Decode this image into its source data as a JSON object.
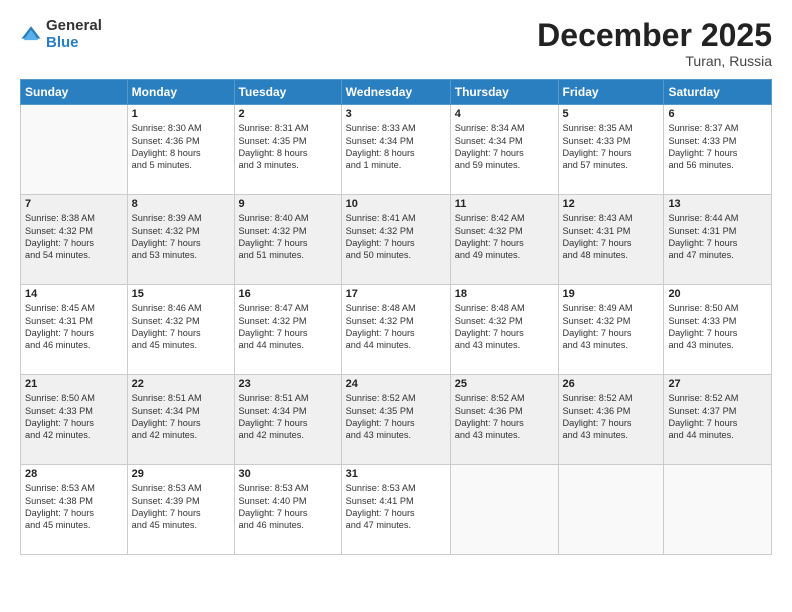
{
  "logo": {
    "general": "General",
    "blue": "Blue"
  },
  "title": "December 2025",
  "location": "Turan, Russia",
  "headers": [
    "Sunday",
    "Monday",
    "Tuesday",
    "Wednesday",
    "Thursday",
    "Friday",
    "Saturday"
  ],
  "rows": [
    [
      {
        "day": "",
        "info": ""
      },
      {
        "day": "1",
        "info": "Sunrise: 8:30 AM\nSunset: 4:36 PM\nDaylight: 8 hours\nand 5 minutes."
      },
      {
        "day": "2",
        "info": "Sunrise: 8:31 AM\nSunset: 4:35 PM\nDaylight: 8 hours\nand 3 minutes."
      },
      {
        "day": "3",
        "info": "Sunrise: 8:33 AM\nSunset: 4:34 PM\nDaylight: 8 hours\nand 1 minute."
      },
      {
        "day": "4",
        "info": "Sunrise: 8:34 AM\nSunset: 4:34 PM\nDaylight: 7 hours\nand 59 minutes."
      },
      {
        "day": "5",
        "info": "Sunrise: 8:35 AM\nSunset: 4:33 PM\nDaylight: 7 hours\nand 57 minutes."
      },
      {
        "day": "6",
        "info": "Sunrise: 8:37 AM\nSunset: 4:33 PM\nDaylight: 7 hours\nand 56 minutes."
      }
    ],
    [
      {
        "day": "7",
        "info": "Sunrise: 8:38 AM\nSunset: 4:32 PM\nDaylight: 7 hours\nand 54 minutes."
      },
      {
        "day": "8",
        "info": "Sunrise: 8:39 AM\nSunset: 4:32 PM\nDaylight: 7 hours\nand 53 minutes."
      },
      {
        "day": "9",
        "info": "Sunrise: 8:40 AM\nSunset: 4:32 PM\nDaylight: 7 hours\nand 51 minutes."
      },
      {
        "day": "10",
        "info": "Sunrise: 8:41 AM\nSunset: 4:32 PM\nDaylight: 7 hours\nand 50 minutes."
      },
      {
        "day": "11",
        "info": "Sunrise: 8:42 AM\nSunset: 4:32 PM\nDaylight: 7 hours\nand 49 minutes."
      },
      {
        "day": "12",
        "info": "Sunrise: 8:43 AM\nSunset: 4:31 PM\nDaylight: 7 hours\nand 48 minutes."
      },
      {
        "day": "13",
        "info": "Sunrise: 8:44 AM\nSunset: 4:31 PM\nDaylight: 7 hours\nand 47 minutes."
      }
    ],
    [
      {
        "day": "14",
        "info": "Sunrise: 8:45 AM\nSunset: 4:31 PM\nDaylight: 7 hours\nand 46 minutes."
      },
      {
        "day": "15",
        "info": "Sunrise: 8:46 AM\nSunset: 4:32 PM\nDaylight: 7 hours\nand 45 minutes."
      },
      {
        "day": "16",
        "info": "Sunrise: 8:47 AM\nSunset: 4:32 PM\nDaylight: 7 hours\nand 44 minutes."
      },
      {
        "day": "17",
        "info": "Sunrise: 8:48 AM\nSunset: 4:32 PM\nDaylight: 7 hours\nand 44 minutes."
      },
      {
        "day": "18",
        "info": "Sunrise: 8:48 AM\nSunset: 4:32 PM\nDaylight: 7 hours\nand 43 minutes."
      },
      {
        "day": "19",
        "info": "Sunrise: 8:49 AM\nSunset: 4:32 PM\nDaylight: 7 hours\nand 43 minutes."
      },
      {
        "day": "20",
        "info": "Sunrise: 8:50 AM\nSunset: 4:33 PM\nDaylight: 7 hours\nand 43 minutes."
      }
    ],
    [
      {
        "day": "21",
        "info": "Sunrise: 8:50 AM\nSunset: 4:33 PM\nDaylight: 7 hours\nand 42 minutes."
      },
      {
        "day": "22",
        "info": "Sunrise: 8:51 AM\nSunset: 4:34 PM\nDaylight: 7 hours\nand 42 minutes."
      },
      {
        "day": "23",
        "info": "Sunrise: 8:51 AM\nSunset: 4:34 PM\nDaylight: 7 hours\nand 42 minutes."
      },
      {
        "day": "24",
        "info": "Sunrise: 8:52 AM\nSunset: 4:35 PM\nDaylight: 7 hours\nand 43 minutes."
      },
      {
        "day": "25",
        "info": "Sunrise: 8:52 AM\nSunset: 4:36 PM\nDaylight: 7 hours\nand 43 minutes."
      },
      {
        "day": "26",
        "info": "Sunrise: 8:52 AM\nSunset: 4:36 PM\nDaylight: 7 hours\nand 43 minutes."
      },
      {
        "day": "27",
        "info": "Sunrise: 8:52 AM\nSunset: 4:37 PM\nDaylight: 7 hours\nand 44 minutes."
      }
    ],
    [
      {
        "day": "28",
        "info": "Sunrise: 8:53 AM\nSunset: 4:38 PM\nDaylight: 7 hours\nand 45 minutes."
      },
      {
        "day": "29",
        "info": "Sunrise: 8:53 AM\nSunset: 4:39 PM\nDaylight: 7 hours\nand 45 minutes."
      },
      {
        "day": "30",
        "info": "Sunrise: 8:53 AM\nSunset: 4:40 PM\nDaylight: 7 hours\nand 46 minutes."
      },
      {
        "day": "31",
        "info": "Sunrise: 8:53 AM\nSunset: 4:41 PM\nDaylight: 7 hours\nand 47 minutes."
      },
      {
        "day": "",
        "info": ""
      },
      {
        "day": "",
        "info": ""
      },
      {
        "day": "",
        "info": ""
      }
    ]
  ]
}
